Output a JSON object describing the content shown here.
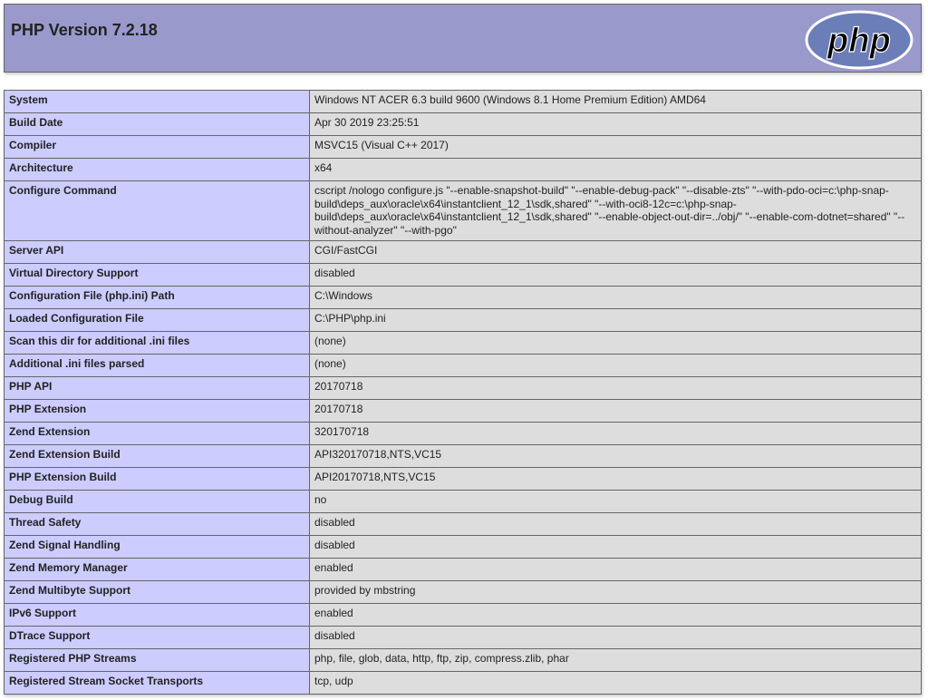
{
  "header": {
    "title": "PHP Version 7.2.18",
    "logo_text": "php"
  },
  "colors": {
    "header_bg": "#9999cc",
    "key_cell_bg": "#ccccff",
    "value_cell_bg": "#dddddd",
    "border": "#666666",
    "logo_fill": "#6c7eb7"
  },
  "rows": [
    {
      "key": "System",
      "value": "Windows NT ACER 6.3 build 9600 (Windows 8.1 Home Premium Edition) AMD64"
    },
    {
      "key": "Build Date",
      "value": "Apr 30 2019 23:25:51"
    },
    {
      "key": "Compiler",
      "value": "MSVC15 (Visual C++ 2017)"
    },
    {
      "key": "Architecture",
      "value": "x64"
    },
    {
      "key": "Configure Command",
      "value": "cscript /nologo configure.js \"--enable-snapshot-build\" \"--enable-debug-pack\" \"--disable-zts\" \"--with-pdo-oci=c:\\php-snap-build\\deps_aux\\oracle\\x64\\instantclient_12_1\\sdk,shared\" \"--with-oci8-12c=c:\\php-snap-build\\deps_aux\\oracle\\x64\\instantclient_12_1\\sdk,shared\" \"--enable-object-out-dir=../obj/\" \"--enable-com-dotnet=shared\" \"--without-analyzer\" \"--with-pgo\""
    },
    {
      "key": "Server API",
      "value": "CGI/FastCGI"
    },
    {
      "key": "Virtual Directory Support",
      "value": "disabled"
    },
    {
      "key": "Configuration File (php.ini) Path",
      "value": "C:\\Windows"
    },
    {
      "key": "Loaded Configuration File",
      "value": "C:\\PHP\\php.ini"
    },
    {
      "key": "Scan this dir for additional .ini files",
      "value": "(none)"
    },
    {
      "key": "Additional .ini files parsed",
      "value": "(none)"
    },
    {
      "key": "PHP API",
      "value": "20170718"
    },
    {
      "key": "PHP Extension",
      "value": "20170718"
    },
    {
      "key": "Zend Extension",
      "value": "320170718"
    },
    {
      "key": "Zend Extension Build",
      "value": "API320170718,NTS,VC15"
    },
    {
      "key": "PHP Extension Build",
      "value": "API20170718,NTS,VC15"
    },
    {
      "key": "Debug Build",
      "value": "no"
    },
    {
      "key": "Thread Safety",
      "value": "disabled"
    },
    {
      "key": "Zend Signal Handling",
      "value": "disabled"
    },
    {
      "key": "Zend Memory Manager",
      "value": "enabled"
    },
    {
      "key": "Zend Multibyte Support",
      "value": "provided by mbstring"
    },
    {
      "key": "IPv6 Support",
      "value": "enabled"
    },
    {
      "key": "DTrace Support",
      "value": "disabled"
    },
    {
      "key": "Registered PHP Streams",
      "value": "php, file, glob, data, http, ftp, zip, compress.zlib, phar"
    },
    {
      "key": "Registered Stream Socket Transports",
      "value": "tcp, udp"
    }
  ]
}
